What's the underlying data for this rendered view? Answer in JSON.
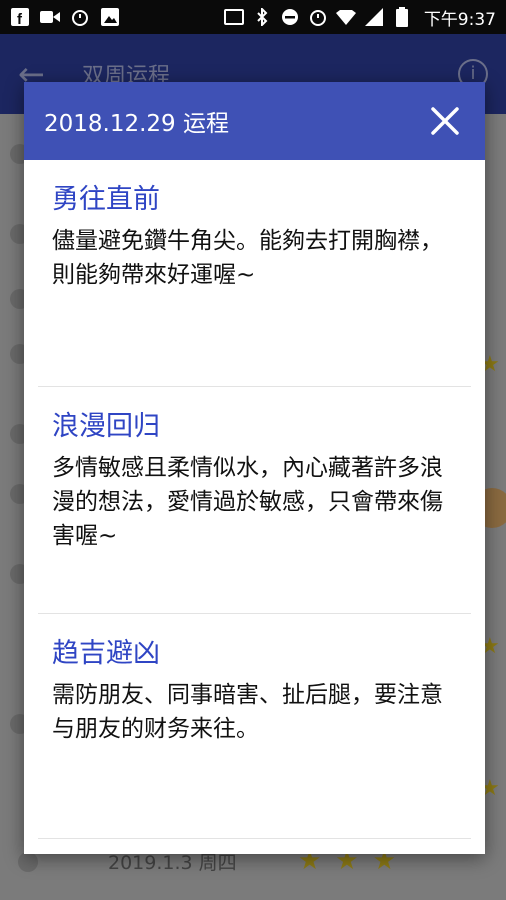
{
  "status_bar": {
    "time": "下午9:37",
    "left_icons": [
      "facebook-icon",
      "video-icon",
      "alarm-icon",
      "image-icon"
    ],
    "right_icons": [
      "cast-icon",
      "bluetooth-icon",
      "do-not-disturb-icon",
      "alarm-icon",
      "wifi-icon",
      "signal-icon",
      "battery-icon"
    ]
  },
  "app_bar": {
    "title": "双周运程"
  },
  "background_list": {
    "last_row_date": "2019.1.3 周四"
  },
  "dialog": {
    "title": "2018.12.29 运程",
    "sections": [
      {
        "title": "勇往直前",
        "body": "儘量避免鑽牛角尖。能夠去打開胸襟，則能夠帶來好運喔~"
      },
      {
        "title": "浪漫回归",
        "body": "多情敏感且柔情似水，內心藏著許多浪漫的想法，愛情過於敏感，只會帶來傷害喔~"
      },
      {
        "title": "趋吉避凶",
        "body": "需防朋友、同事暗害、扯后腿，要注意与朋友的财务来往。"
      }
    ]
  },
  "colors": {
    "header_blue": "#3f51b5",
    "title_blue": "#2f45c4",
    "star_gold": "#f5c518"
  }
}
